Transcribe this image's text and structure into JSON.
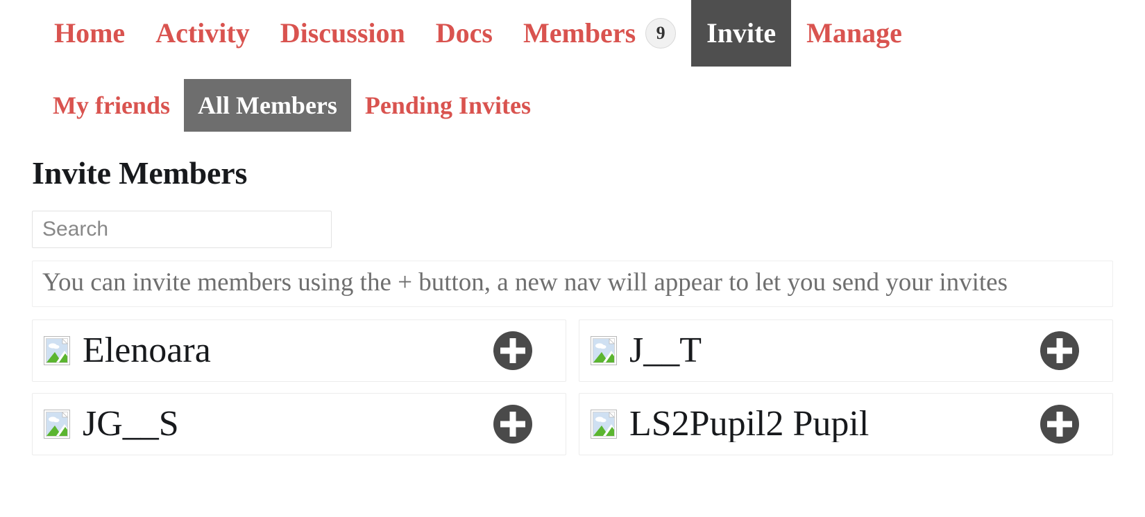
{
  "group_nav": {
    "items": [
      {
        "label": "Home",
        "current": false,
        "badge": null
      },
      {
        "label": "Activity",
        "current": false,
        "badge": null
      },
      {
        "label": "Discussion",
        "current": false,
        "badge": null
      },
      {
        "label": "Docs",
        "current": false,
        "badge": null
      },
      {
        "label": "Members",
        "current": false,
        "badge": "9"
      },
      {
        "label": "Invite",
        "current": true,
        "badge": null
      },
      {
        "label": "Manage",
        "current": false,
        "badge": null
      }
    ]
  },
  "sub_nav": {
    "items": [
      {
        "label": "My friends",
        "current": false
      },
      {
        "label": "All Members",
        "current": true
      },
      {
        "label": "Pending Invites",
        "current": false
      }
    ]
  },
  "main": {
    "title": "Invite Members",
    "search": {
      "placeholder": "Search",
      "value": ""
    },
    "info_message": "You can invite members using the + button, a new nav will appear to let you send your invites",
    "members": [
      {
        "name": "Elenoara",
        "avatar": "broken-image-icon",
        "action": "invite-plus-icon"
      },
      {
        "name": "J__T",
        "avatar": "broken-image-icon",
        "action": "invite-plus-icon"
      },
      {
        "name": "JG__S",
        "avatar": "broken-image-icon",
        "action": "invite-plus-icon"
      },
      {
        "name": "LS2Pupil2 Pupil",
        "avatar": "broken-image-icon",
        "action": "invite-plus-icon"
      }
    ]
  },
  "colors": {
    "link_red": "#d9534f",
    "current_tab_bg": "#4f4f4f",
    "current_subtab_bg": "#6e6e6e",
    "plus_button": "#4a4a4a",
    "info_text": "#6f6f6f",
    "title_text": "#17191c",
    "border": "#ececec"
  }
}
